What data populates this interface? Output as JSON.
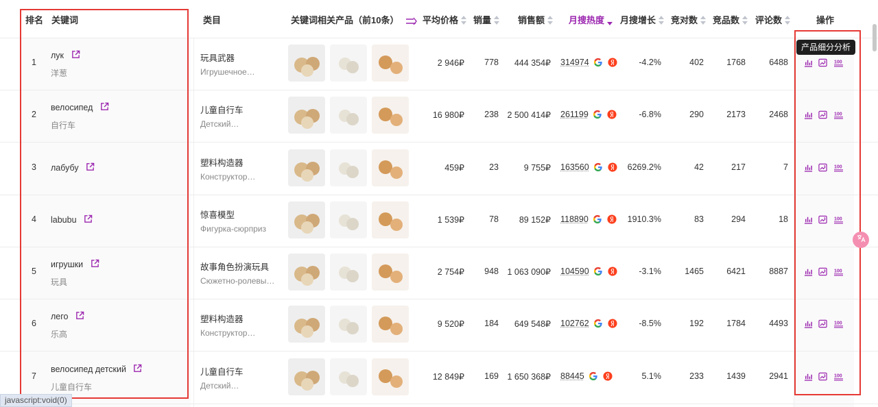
{
  "header": {
    "rank": "排名",
    "keyword": "关键词",
    "category": "类目",
    "related_products": "关键词相关产品（前10条）",
    "avg_price": "平均价格",
    "sales": "销量",
    "revenue": "销售额",
    "monthly_heat": "月搜热度",
    "monthly_growth": "月搜增长",
    "competitors": "竞对数",
    "products": "竞品数",
    "reviews": "评论数",
    "actions": "操作"
  },
  "tooltip": "产品细分分析",
  "status_bar": "javascript:void(0)",
  "rows": [
    {
      "rank": "1",
      "keyword": "лук",
      "keyword_cn": "洋葱",
      "category": "玩具武器",
      "category_ru": "Игрушечное…",
      "price": "2 946₽",
      "sales": "778",
      "revenue": "444 354₽",
      "heat": "314974",
      "growth": "-4.2%",
      "competitors": "402",
      "products": "1768",
      "reviews": "6488"
    },
    {
      "rank": "2",
      "keyword": "велосипед",
      "keyword_cn": "自行车",
      "category": "儿童自行车",
      "category_ru": "Детский…",
      "price": "16 980₽",
      "sales": "238",
      "revenue": "2 500 414₽",
      "heat": "261199",
      "growth": "-6.8%",
      "competitors": "290",
      "products": "2173",
      "reviews": "2468"
    },
    {
      "rank": "3",
      "keyword": "лабубу",
      "keyword_cn": "",
      "category": "塑料构造器",
      "category_ru": "Конструктор…",
      "price": "459₽",
      "sales": "23",
      "revenue": "9 755₽",
      "heat": "163560",
      "growth": "6269.2%",
      "competitors": "42",
      "products": "217",
      "reviews": "7"
    },
    {
      "rank": "4",
      "keyword": "labubu",
      "keyword_cn": "",
      "category": "惊喜模型",
      "category_ru": "Фигурка-сюрприз",
      "price": "1 539₽",
      "sales": "78",
      "revenue": "89 152₽",
      "heat": "118890",
      "growth": "1910.3%",
      "competitors": "83",
      "products": "294",
      "reviews": "18"
    },
    {
      "rank": "5",
      "keyword": "игрушки",
      "keyword_cn": "玩具",
      "category": "故事角色扮演玩具",
      "category_ru": "Сюжетно-ролевы…",
      "price": "2 754₽",
      "sales": "948",
      "revenue": "1 063 090₽",
      "heat": "104590",
      "growth": "-3.1%",
      "competitors": "1465",
      "products": "6421",
      "reviews": "8887"
    },
    {
      "rank": "6",
      "keyword": "лего",
      "keyword_cn": "乐高",
      "category": "塑料构造器",
      "category_ru": "Конструктор…",
      "price": "9 520₽",
      "sales": "184",
      "revenue": "649 548₽",
      "heat": "102762",
      "growth": "-8.5%",
      "competitors": "192",
      "products": "1784",
      "reviews": "4493"
    },
    {
      "rank": "7",
      "keyword": "велосипед детский",
      "keyword_cn": "儿童自行车",
      "category": "儿童自行车",
      "category_ru": "Детский…",
      "price": "12 849₽",
      "sales": "169",
      "revenue": "1 650 368₽",
      "heat": "88445",
      "growth": "5.1%",
      "competitors": "233",
      "products": "1439",
      "reviews": "2941"
    }
  ],
  "colors": {
    "accent": "#9c27b0",
    "highlight_box": "#e53935",
    "google": "#4285f4",
    "yandex": "#fc3f1d"
  },
  "icons": {
    "external": "external-link-icon",
    "google": "google-icon",
    "yandex": "yandex-icon",
    "chart": "bar-chart-icon",
    "analysis": "image-analysis-icon",
    "top100": "top-100-icon",
    "expand": "expand-arrow-icon"
  }
}
